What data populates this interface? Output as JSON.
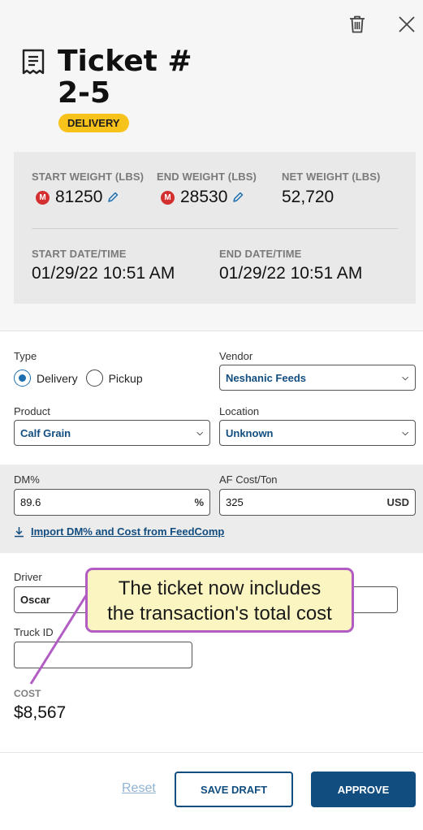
{
  "header": {
    "title_line1": "Ticket #",
    "title_line2": "2-5",
    "badge": "DELIVERY",
    "icons": {
      "delete": "trash-icon",
      "close": "close-icon",
      "ticket": "receipt-icon"
    }
  },
  "weights": {
    "start_weight": {
      "label": "START WEIGHT (LBS)",
      "badge": "M",
      "value": "81250"
    },
    "end_weight": {
      "label": "END WEIGHT (LBS)",
      "badge": "M",
      "value": "28530"
    },
    "net_weight": {
      "label": "NET WEIGHT (LBS)",
      "value": "52,720"
    },
    "start_datetime": {
      "label": "START DATE/TIME",
      "value": "01/29/22 10:51 AM"
    },
    "end_datetime": {
      "label": "END DATE/TIME",
      "value": "01/29/22 10:51 AM"
    }
  },
  "form": {
    "type": {
      "label": "Type",
      "options": [
        "Delivery",
        "Pickup"
      ],
      "selected": "Delivery"
    },
    "vendor": {
      "label": "Vendor",
      "value": "Neshanic Feeds"
    },
    "product": {
      "label": "Product",
      "value": "Calf Grain"
    },
    "location": {
      "label": "Location",
      "value": "Unknown"
    },
    "dm": {
      "label": "DM%",
      "value": "89.6",
      "unit": "%"
    },
    "af_cost": {
      "label": "AF Cost/Ton",
      "value": "325",
      "unit": "USD"
    },
    "import_link": "Import DM% and Cost from FeedComp",
    "driver": {
      "label": "Driver",
      "value": "Oscar"
    },
    "truck_id": {
      "label": "Truck ID",
      "value": ""
    },
    "cost": {
      "label": "COST",
      "value": "$8,567"
    }
  },
  "footer": {
    "reset": "Reset",
    "save_draft": "SAVE DRAFT",
    "approve": "APPROVE"
  },
  "callout": {
    "line1": "The ticket now includes",
    "line2": "the transaction's total cost"
  },
  "colors": {
    "primary": "#124d80",
    "badge_yellow": "#f7c21a",
    "manual_badge_red": "#d3302f",
    "callout_border": "#b15dc4",
    "callout_fill": "#fbf5c2"
  }
}
